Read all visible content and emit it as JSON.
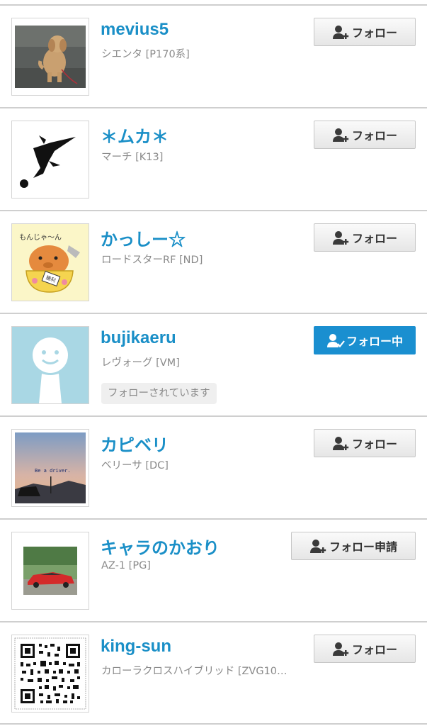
{
  "users": [
    {
      "name": "mevius5",
      "car": "シエンタ [P170系]",
      "button": "フォロー",
      "button_icon": "user-plus-icon",
      "avatar": "dog-photo"
    },
    {
      "name": "＊ムカ＊",
      "car": "マーチ [K13]",
      "button": "フォロー",
      "button_icon": "user-plus-icon",
      "avatar": "soccer-silhouette"
    },
    {
      "name": "かっしー☆",
      "car": "ロードスターRF [ND]",
      "button": "フォロー",
      "button_icon": "user-plus-icon",
      "avatar": "capybara-illustration",
      "avatar_text": [
        "もんじゃ〜ん",
        "勝利"
      ]
    },
    {
      "name": "bujikaeru",
      "car": "レヴォーグ [VM]",
      "button": "フォロー中",
      "button_icon": "user-check-icon",
      "status_badge": "フォローされています",
      "avatar": "default-avatar"
    },
    {
      "name": "カピベリ",
      "car": "ベリーサ [DC]",
      "button": "フォロー",
      "button_icon": "user-plus-icon",
      "avatar": "dusk-car-photo",
      "avatar_text": "Be a driver."
    },
    {
      "name": "キャラのかおり",
      "car": "AZ-1 [PG]",
      "button": "フォロー申請",
      "button_icon": "user-plus-icon",
      "avatar": "red-car-photo"
    },
    {
      "name": "king-sun",
      "car": "カローラクロスハイブリッド [ZVG10…",
      "button": "フォロー",
      "button_icon": "user-plus-icon",
      "avatar": "qr-code"
    }
  ],
  "colors": {
    "name": "#1a8fc7",
    "following_button": "#1a8fd0",
    "divider": "#cfcfcf"
  }
}
